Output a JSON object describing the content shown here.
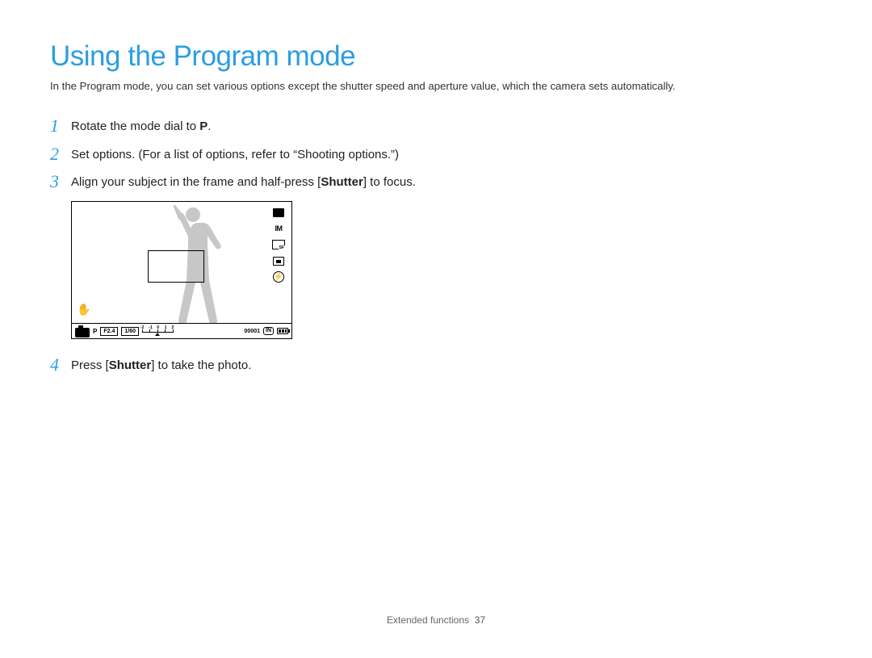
{
  "title": "Using the Program mode",
  "intro": "In the Program mode, you can set various options except the shutter speed and aperture value, which the camera sets automatically.",
  "steps": {
    "s1_pre": "Rotate the mode dial to ",
    "s1_glyph": "P",
    "s1_post": ".",
    "s2": "Set options. (For a list of options, refer to “Shooting options.”)",
    "s3_pre": "Align your subject in the frame and half-press [",
    "s3_bold": "Shutter",
    "s3_post": "] to focus.",
    "s4_pre": "Press [",
    "s4_bold": "Shutter",
    "s4_post": "] to take the photo."
  },
  "lcd": {
    "mode_p": "P",
    "im_label": "IM",
    "flash_glyph": "⚡",
    "hand_glyph": "✋",
    "fstop": "F2.4",
    "shutter": "1/60",
    "ev_labels": [
      "-2",
      "-1",
      "0",
      "1",
      "2"
    ],
    "counter": "00001",
    "in_label": "IN"
  },
  "nums": {
    "n1": "1",
    "n2": "2",
    "n3": "3",
    "n4": "4"
  },
  "footer": {
    "section": "Extended functions",
    "page": "37"
  }
}
